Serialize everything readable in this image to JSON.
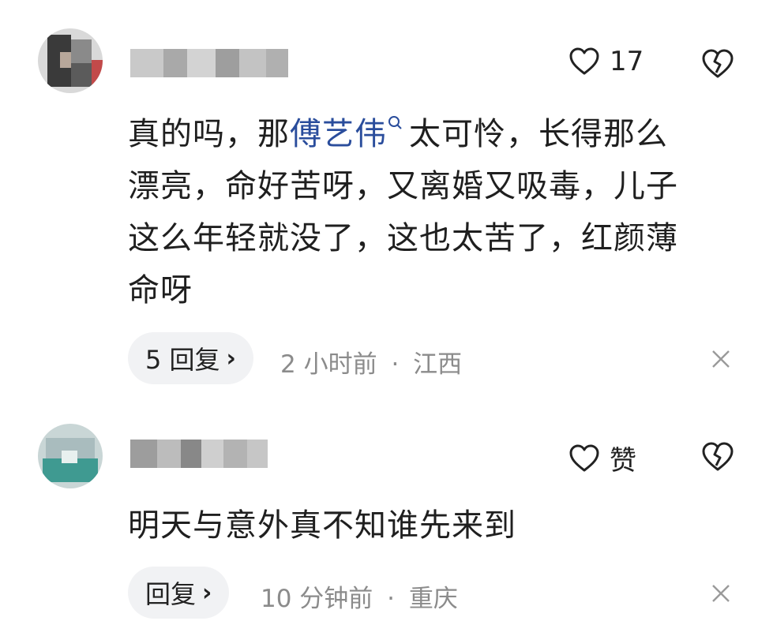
{
  "comments": [
    {
      "like_count": "17",
      "text_before_link": "真的吗，那",
      "link_text": "傅艺伟",
      "text_after_link": "太可怜，长得那么",
      "lines": [
        "漂亮，命好苦呀，又离婚又吸毒，儿子",
        "这么年轻就没了，这也太苦了，红颜薄",
        "命呀"
      ],
      "reply_label": "5 回复",
      "time": "2 小时前",
      "location": "江西"
    },
    {
      "like_label": "赞",
      "text": "明天与意外真不知谁先来到",
      "reply_label": "回复",
      "time": "10 分钟前",
      "location": "重庆"
    }
  ],
  "separator": "·",
  "icons": {
    "like": "heart-outline-icon",
    "dislike": "broken-heart-icon",
    "reply_more": "chevron-right-icon",
    "close": "close-icon",
    "search": "search-icon"
  },
  "colors": {
    "link": "#2a4d9c",
    "meta": "#8b8b8b",
    "pill_bg": "#f1f2f4"
  }
}
